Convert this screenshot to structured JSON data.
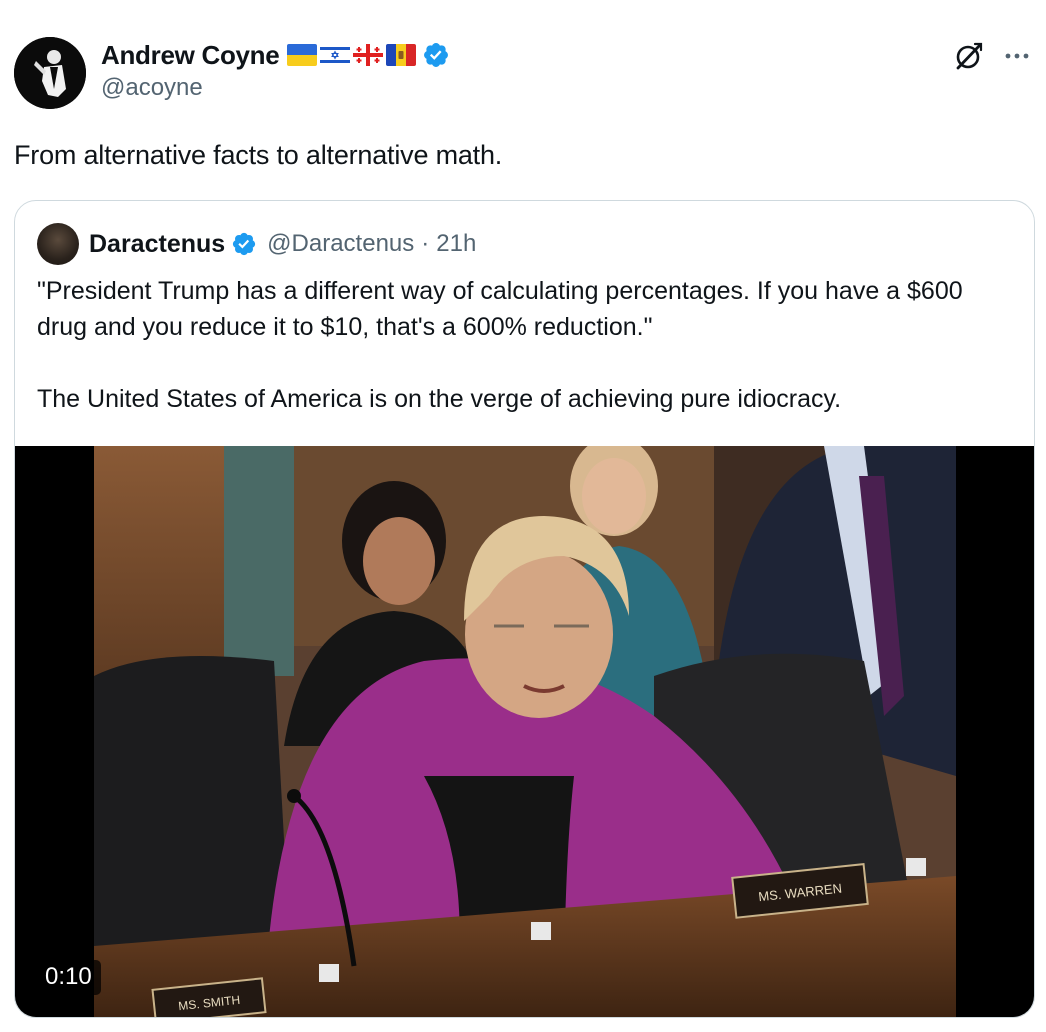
{
  "author": {
    "display_name": "Andrew Coyne",
    "handle": "@acoyne",
    "flags": [
      "ukraine-flag",
      "israel-flag",
      "georgia-flag",
      "moldova-flag"
    ],
    "verified": true
  },
  "tweet": {
    "text": "From alternative facts to alternative math."
  },
  "quote": {
    "display_name": "Daractenus",
    "handle": "@Daractenus",
    "separator": "·",
    "time": "21h",
    "verified": true,
    "paragraph_1": "\"President Trump has a different way of calculating percentages. If you have a $600 drug and you reduce it to $10, that's a 600% reduction.\"",
    "paragraph_2": "The United States of America is on the verge of achieving pure idiocracy."
  },
  "video": {
    "timestamp": "0:10",
    "nameplate_1": "MS. WARREN",
    "nameplate_2": "MS. SMITH"
  },
  "icons": {
    "grok": "grok-icon",
    "more": "more-icon",
    "verified": "verified-badge-icon"
  },
  "colors": {
    "verified_blue": "#1d9bf0",
    "text_primary": "#0f1419",
    "text_secondary": "#536471",
    "border": "#cfd9de",
    "jacket": "#9a2e8a"
  }
}
